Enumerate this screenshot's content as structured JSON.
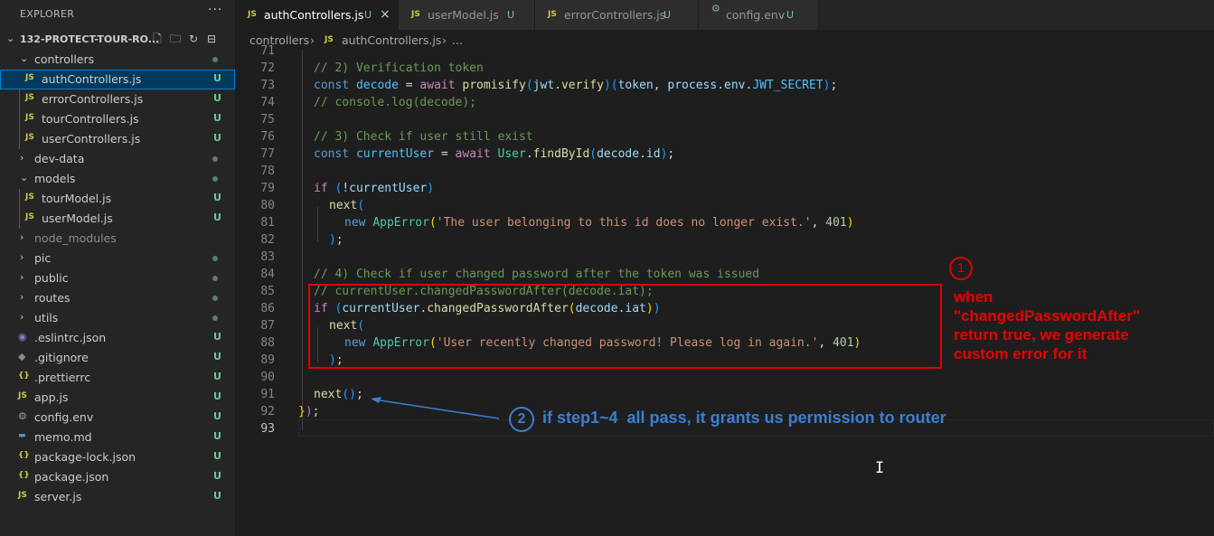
{
  "explorer": {
    "title": "EXPLORER",
    "more": "···",
    "project": "132-PROTECT-TOUR-RO...",
    "items": [
      {
        "label": "controllers",
        "type": "folder-open"
      },
      {
        "label": "authControllers.js",
        "type": "js",
        "status": "U",
        "selected": true
      },
      {
        "label": "errorControllers.js",
        "type": "js",
        "status": "U"
      },
      {
        "label": "tourControllers.js",
        "type": "js",
        "status": "U"
      },
      {
        "label": "userControllers.js",
        "type": "js",
        "status": "U"
      },
      {
        "label": "dev-data",
        "type": "folder"
      },
      {
        "label": "models",
        "type": "folder-open"
      },
      {
        "label": "tourModel.js",
        "type": "js",
        "status": "U"
      },
      {
        "label": "userModel.js",
        "type": "js",
        "status": "U"
      },
      {
        "label": "node_modules",
        "type": "folder"
      },
      {
        "label": "pic",
        "type": "folder"
      },
      {
        "label": "public",
        "type": "folder"
      },
      {
        "label": "routes",
        "type": "folder"
      },
      {
        "label": "utils",
        "type": "folder"
      },
      {
        "label": ".eslintrc.json",
        "type": "eslint",
        "status": "U"
      },
      {
        "label": ".gitignore",
        "type": "git",
        "status": "U"
      },
      {
        "label": ".prettierrc",
        "type": "json",
        "status": "U"
      },
      {
        "label": "app.js",
        "type": "js",
        "status": "U"
      },
      {
        "label": "config.env",
        "type": "gear",
        "status": "U"
      },
      {
        "label": "memo.md",
        "type": "md",
        "status": "U"
      },
      {
        "label": "package-lock.json",
        "type": "json",
        "status": "U"
      },
      {
        "label": "package.json",
        "type": "json",
        "status": "U"
      },
      {
        "label": "server.js",
        "type": "js",
        "status": "U"
      }
    ]
  },
  "tabs": [
    {
      "label": "authControllers.js",
      "status": "U",
      "active": true
    },
    {
      "label": "userModel.js",
      "status": "U"
    },
    {
      "label": "errorControllers.js",
      "status": "U"
    },
    {
      "label": "config.env",
      "status": "U"
    }
  ],
  "icons": {
    "js": "JS",
    "json": "{}",
    "gear": "⚙",
    "md": "▬",
    "close": "×"
  },
  "breadcrumb": {
    "folder": "controllers",
    "file": "authControllers.js",
    "ellipsis": "..."
  },
  "code_lines": [
    71,
    72,
    73,
    74,
    75,
    76,
    77,
    78,
    79,
    80,
    81,
    82,
    83,
    84,
    85,
    86,
    87,
    88,
    89,
    90,
    91,
    92,
    93
  ],
  "code": {
    "l72": "// 2) Verification token",
    "l74": "// console.log(decode);",
    "l76": "// 3) Check if user still exist",
    "l81_str": "'The user belonging to this id does no longer exist.'",
    "l81_num": "401",
    "l84": "// 4) Check if user changed password after the token was issued",
    "l85": "// currentUser.changedPasswordAfter(decode.iat);",
    "l88_str": "'User recently changed password! Please log in again.'",
    "l88_num": "401"
  },
  "annotations": {
    "step1_number": "1",
    "step1_lines": [
      "when",
      "\"changedPasswordAfter\"",
      "return true, we generate",
      "custom error for it"
    ],
    "step2_number": "2",
    "step2_text": "if step1~4  all pass, it grants us permission to router"
  },
  "colors": {
    "annotation_red": "#e00000",
    "annotation_blue": "#3a7fd5",
    "untracked_green": "#73c991"
  }
}
